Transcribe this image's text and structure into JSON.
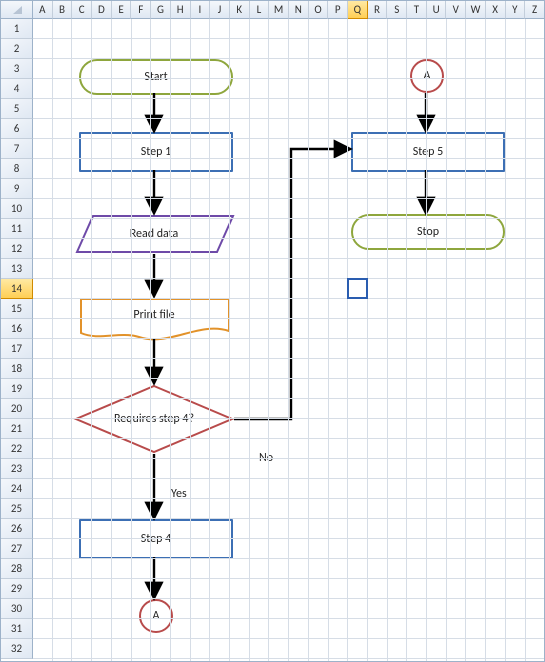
{
  "columns": [
    "A",
    "B",
    "C",
    "D",
    "E",
    "F",
    "G",
    "H",
    "I",
    "J",
    "K",
    "L",
    "M",
    "N",
    "O",
    "P",
    "Q",
    "R",
    "S",
    "T",
    "U",
    "V",
    "W",
    "X",
    "Y",
    "Z"
  ],
  "selectedColumn": "Q",
  "rowCount": 32,
  "selectedRow": 14,
  "activeCellAddress": "Q14",
  "flow": {
    "start": "Start",
    "step1": "Step 1",
    "readData": "Read data",
    "printFile": "Print file",
    "decision": "Requires step 4?",
    "no": "No",
    "yes": "Yes",
    "step4": "Step 4",
    "connectorA": "A",
    "step5": "Step 5",
    "stop": "Stop"
  },
  "chart_data": {
    "type": "flowchart",
    "nodes": [
      {
        "id": "start",
        "type": "terminator",
        "label": "Start"
      },
      {
        "id": "step1",
        "type": "process",
        "label": "Step 1"
      },
      {
        "id": "readData",
        "type": "data",
        "label": "Read data"
      },
      {
        "id": "printFile",
        "type": "document",
        "label": "Print file"
      },
      {
        "id": "decision",
        "type": "decision",
        "label": "Requires step 4?"
      },
      {
        "id": "step4",
        "type": "process",
        "label": "Step 4"
      },
      {
        "id": "A_out",
        "type": "connector",
        "label": "A"
      },
      {
        "id": "A_in",
        "type": "connector",
        "label": "A"
      },
      {
        "id": "step5",
        "type": "process",
        "label": "Step 5"
      },
      {
        "id": "stop",
        "type": "terminator",
        "label": "Stop"
      }
    ],
    "edges": [
      {
        "from": "start",
        "to": "step1"
      },
      {
        "from": "step1",
        "to": "readData"
      },
      {
        "from": "readData",
        "to": "printFile"
      },
      {
        "from": "printFile",
        "to": "decision"
      },
      {
        "from": "decision",
        "to": "step4",
        "label": "Yes"
      },
      {
        "from": "decision",
        "to": "step5",
        "label": "No"
      },
      {
        "from": "step4",
        "to": "A_out"
      },
      {
        "from": "A_in",
        "to": "step5"
      },
      {
        "from": "step5",
        "to": "stop"
      }
    ]
  }
}
